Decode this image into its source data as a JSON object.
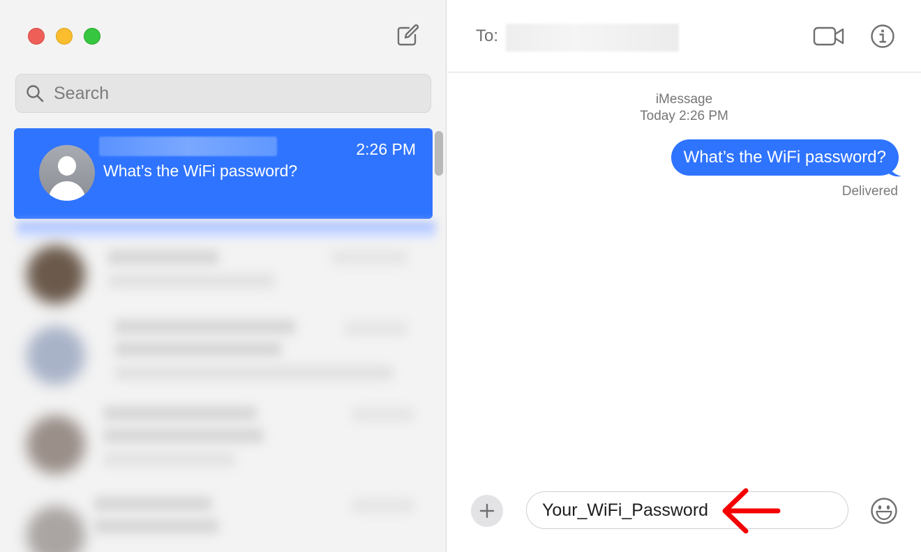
{
  "window": {
    "traffic_lights": [
      "close",
      "minimize",
      "maximize"
    ],
    "colors": {
      "close": "#ee5f58",
      "minimize": "#f9bd2e",
      "maximize": "#37c63f",
      "accent": "#2f74ff"
    }
  },
  "sidebar": {
    "compose_icon": "compose-icon",
    "search": {
      "placeholder": "Search",
      "icon": "search-icon"
    },
    "active_conversation": {
      "time": "2:26 PM",
      "preview": "What’s the WiFi password?"
    }
  },
  "conversation": {
    "header": {
      "to_label": "To:",
      "video_icon": "video-camera-icon",
      "info_icon": "info-icon"
    },
    "service_label": "iMessage",
    "timestamp": "Today 2:26 PM",
    "messages": [
      {
        "direction": "outgoing",
        "text": "What’s the WiFi password?",
        "status": "Delivered"
      }
    ],
    "composer": {
      "apps_icon": "plus-icon",
      "value": "Your_WiFi_Password",
      "emoji_icon": "emoji-icon"
    }
  },
  "annotation": {
    "arrow_color": "#f40000"
  }
}
